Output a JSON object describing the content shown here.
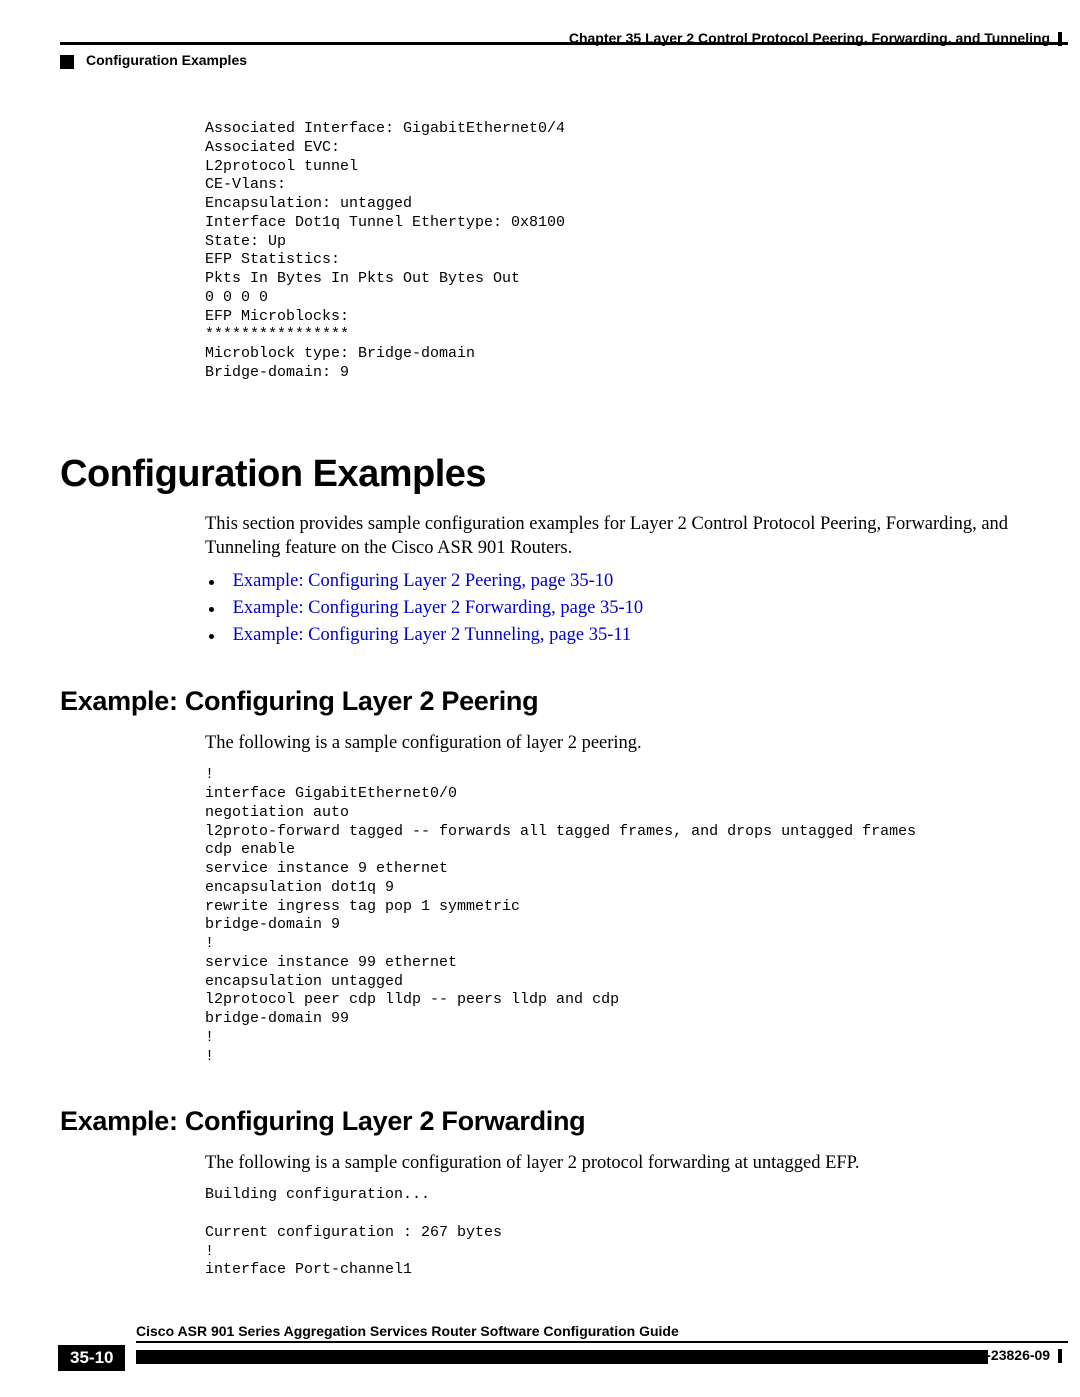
{
  "header": {
    "chapter": "Chapter 35    Layer 2 Control Protocol Peering, Forwarding, and Tunneling",
    "section": "Configuration Examples"
  },
  "code1": "Associated Interface: GigabitEthernet0/4\nAssociated EVC:\nL2protocol tunnel\nCE-Vlans:\nEncapsulation: untagged\nInterface Dot1q Tunnel Ethertype: 0x8100\nState: Up\nEFP Statistics:\nPkts In Bytes In Pkts Out Bytes Out\n0 0 0 0\nEFP Microblocks:\n****************\nMicroblock type: Bridge-domain\nBridge-domain: 9",
  "h1": "Configuration Examples",
  "intro": "This section provides sample configuration examples for Layer 2 Control Protocol Peering, Forwarding, and Tunneling feature on the Cisco ASR 901 Routers.",
  "links": {
    "l1": "Example: Configuring Layer 2 Peering, page 35-10",
    "l2": "Example: Configuring Layer 2 Forwarding, page 35-10",
    "l3": "Example: Configuring Layer 2 Tunneling, page 35-11"
  },
  "h2a": "Example: Configuring Layer 2 Peering",
  "p_a": "The following is a sample configuration of layer 2 peering.",
  "code2": "!\ninterface GigabitEthernet0/0\nnegotiation auto\nl2proto-forward tagged -- forwards all tagged frames, and drops untagged frames\ncdp enable\nservice instance 9 ethernet\nencapsulation dot1q 9\nrewrite ingress tag pop 1 symmetric\nbridge-domain 9\n!\nservice instance 99 ethernet\nencapsulation untagged\nl2protocol peer cdp lldp -- peers lldp and cdp\nbridge-domain 99\n!\n!",
  "h2b": "Example: Configuring Layer 2 Forwarding",
  "p_b": "The following is a sample configuration of layer 2 protocol forwarding at untagged EFP.",
  "code3": "Building configuration...\n\nCurrent configuration : 267 bytes\n!\ninterface Port-channel1",
  "footer": {
    "title": "Cisco ASR 901 Series Aggregation Services Router Software Configuration Guide",
    "page": "35-10",
    "doc": "OL-23826-09"
  }
}
